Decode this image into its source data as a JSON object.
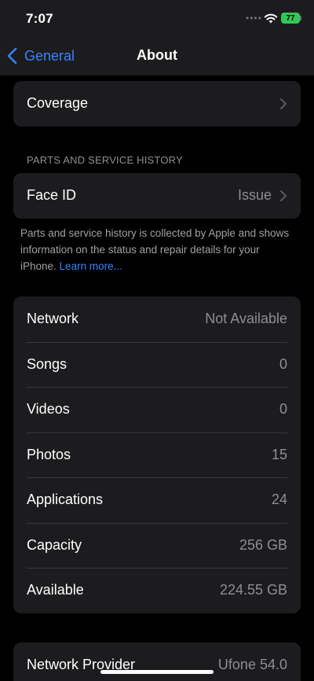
{
  "status_bar": {
    "time": "7:07",
    "signal_dots": "••••",
    "battery_level": "77",
    "battery_color": "#33c759"
  },
  "nav": {
    "back_label": "General",
    "title": "About",
    "accent_color": "#3b82f6"
  },
  "coverage": {
    "label": "Coverage"
  },
  "parts_history": {
    "header": "PARTS AND SERVICE HISTORY",
    "face_id_label": "Face ID",
    "face_id_value": "Issue",
    "footer_text": "Parts and service history is collected by Apple and shows information on the status and repair details for your iPhone. ",
    "footer_link": "Learn more..."
  },
  "info_rows": [
    {
      "label": "Network",
      "value": "Not Available"
    },
    {
      "label": "Songs",
      "value": "0"
    },
    {
      "label": "Videos",
      "value": "0"
    },
    {
      "label": "Photos",
      "value": "15"
    },
    {
      "label": "Applications",
      "value": "24"
    },
    {
      "label": "Capacity",
      "value": "256 GB"
    },
    {
      "label": "Available",
      "value": "224.55 GB"
    }
  ],
  "provider": {
    "label": "Network Provider",
    "value": "Ufone 54.0"
  }
}
